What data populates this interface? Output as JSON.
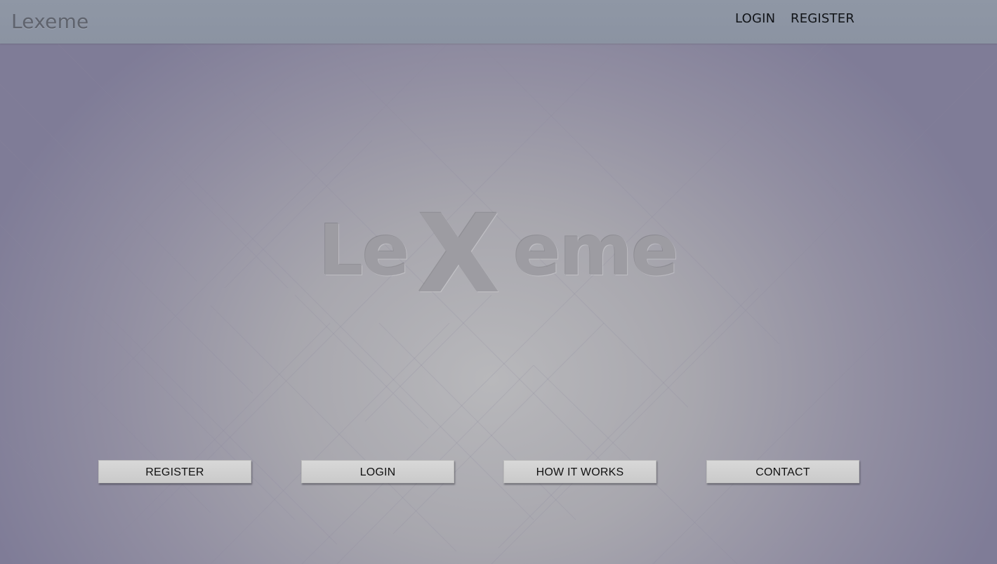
{
  "header": {
    "brand": "Lexeme",
    "nav": {
      "login": "LOGIN",
      "register": "REGISTER"
    }
  },
  "hero": {
    "logo_parts": {
      "left": "Le",
      "emphasis": "X",
      "right": "eme"
    }
  },
  "actions": {
    "register": "REGISTER",
    "login": "LOGIN",
    "how_it_works": "HOW IT WORKS",
    "contact": "CONTACT"
  },
  "colors": {
    "header_bg": "#8f97a5",
    "page_bg": "#a9a8ae",
    "button_bg": "#d0d0d0",
    "text_dark": "#111418",
    "brand_text": "#5f636d",
    "logo_text": "#9d9ca2"
  }
}
